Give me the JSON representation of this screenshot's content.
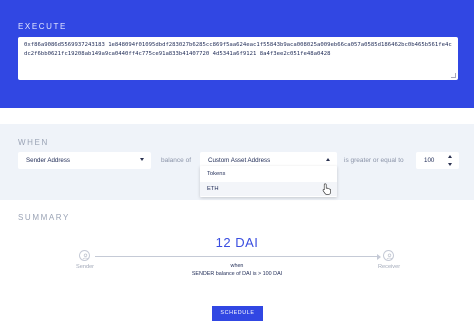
{
  "execute": {
    "title": "EXECUTE",
    "code": "0xf86a9086d5569937243183 1e848094f01095dbdf283027b6285cc869f5aa624eac1f55843b9aca008025a009eb66ca057a0585d186462bc0b465b561fe4cdc2f6bb0621fc19208ab149a9ca0440ff4c775ce91a833b41407720 4d5341a6f9121 8a4f3ee2c051fe48a0428"
  },
  "when": {
    "title": "WHEN",
    "sender_select": "Sender Address",
    "balance_of_text": "balance of",
    "asset_select": "Custom Asset Address",
    "comparison_text": "is greater or equal to",
    "amount_value": "100",
    "dropdown_options": [
      "Tokens",
      "ETH"
    ]
  },
  "summary": {
    "title": "SUMMARY",
    "amount": "12 DAI",
    "sender_label": "Sender",
    "receiver_label": "Receiver",
    "when_label": "when",
    "condition": "SENDER balance of DAI is > 100 DAI"
  },
  "schedule_label": "SCHEDULE"
}
